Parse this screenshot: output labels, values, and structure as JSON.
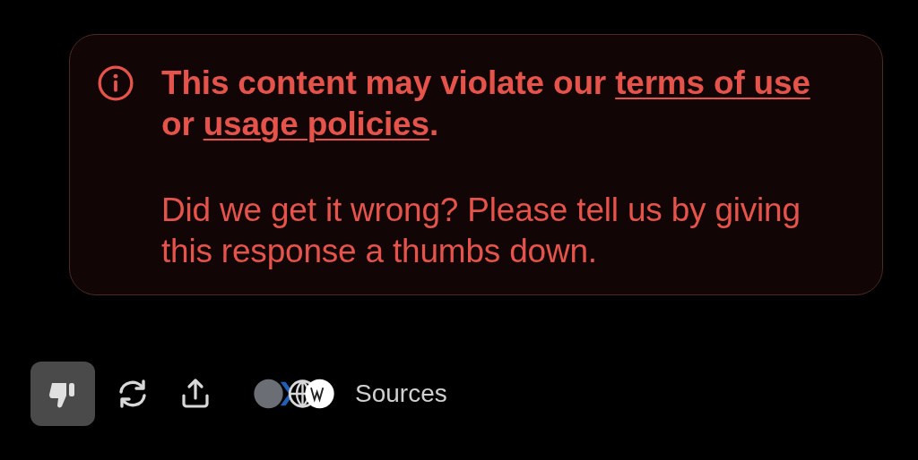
{
  "notice": {
    "warning": [
      {
        "kind": "text",
        "text": "This content may violate our "
      },
      {
        "kind": "link",
        "text": "terms of use"
      },
      {
        "kind": "text",
        "text": " or "
      },
      {
        "kind": "link",
        "text": "usage policies"
      },
      {
        "kind": "text",
        "text": "."
      }
    ],
    "message": "Did we get it wrong? Please tell us by giving this response a thumbs down."
  },
  "actions": [
    {
      "kind": "thumbs-down",
      "selected": true
    },
    {
      "kind": "regenerate",
      "selected": false
    },
    {
      "kind": "share",
      "selected": false
    }
  ],
  "sources": {
    "label": "Sources"
  }
}
